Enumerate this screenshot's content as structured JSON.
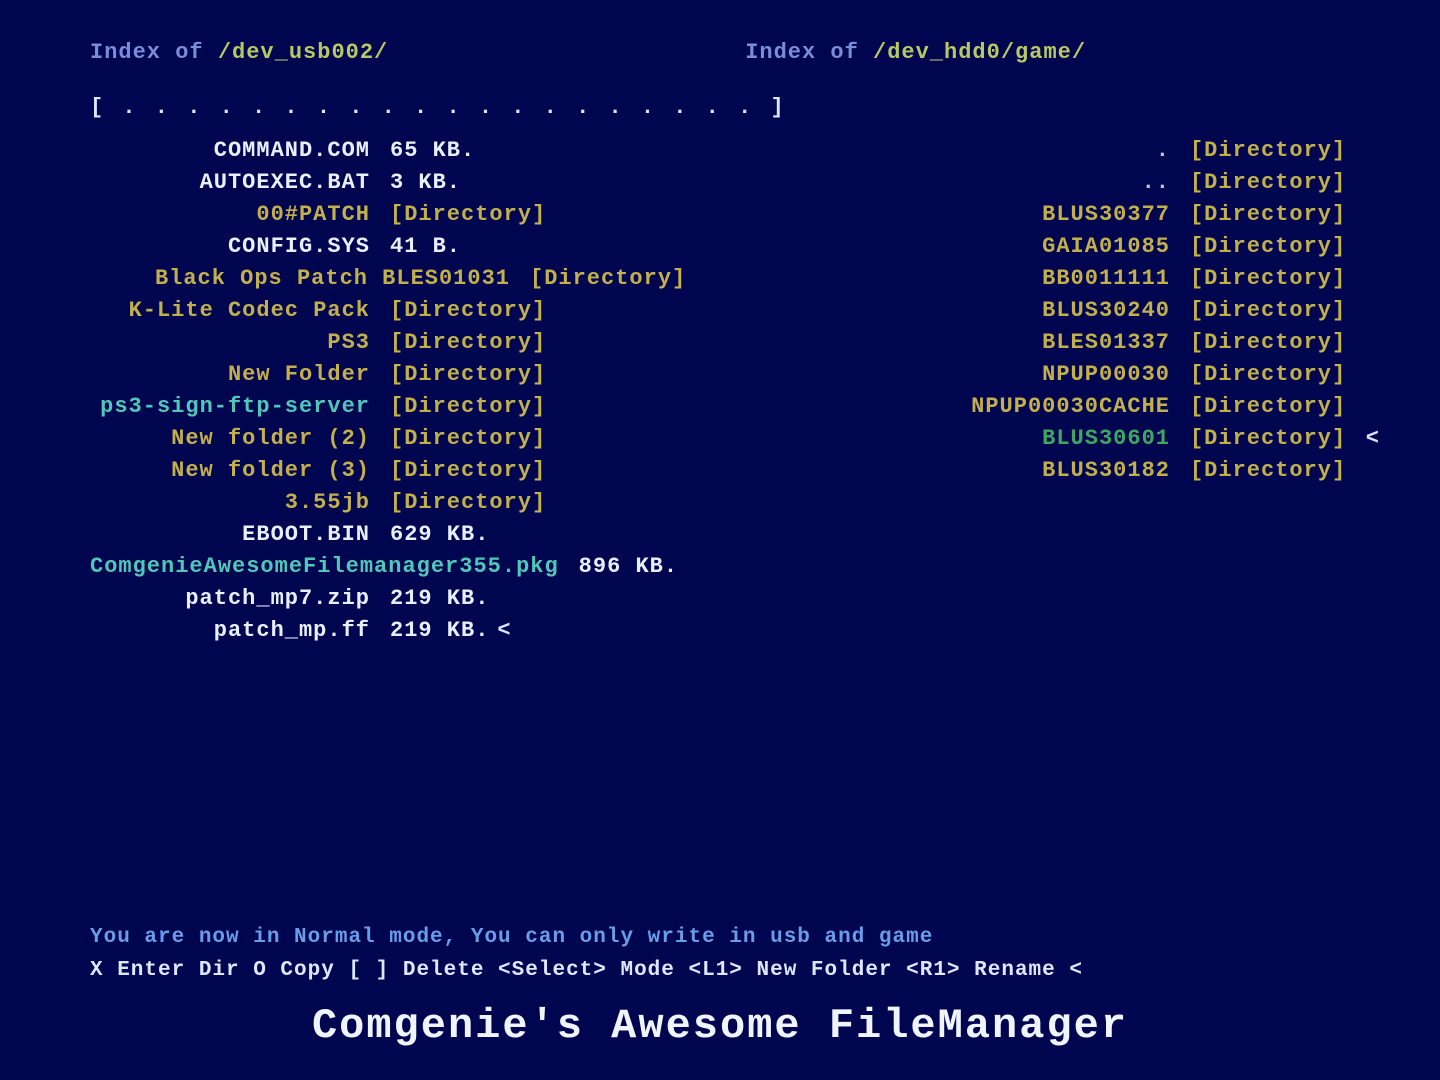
{
  "left_header": {
    "label": "Index of ",
    "path": "/dev_usb002/"
  },
  "right_header": {
    "label": "Index of ",
    "path": "/dev_hdd0/game/"
  },
  "progress": "[ . . . . . . . . . . . . . . . . . . . . ]",
  "left_files": [
    {
      "name": "COMMAND.COM",
      "info": "65 KB.",
      "name_class": "c-white",
      "info_class": "c-white",
      "wide": false,
      "cursor": false
    },
    {
      "name": "AUTOEXEC.BAT",
      "info": "3 KB.",
      "name_class": "c-white",
      "info_class": "c-white",
      "wide": false,
      "cursor": false
    },
    {
      "name": "00#PATCH",
      "info": "[Directory]",
      "name_class": "c-yellow",
      "info_class": "c-yellow",
      "wide": false,
      "cursor": false
    },
    {
      "name": "CONFIG.SYS",
      "info": "41 B.",
      "name_class": "c-white",
      "info_class": "c-white",
      "wide": false,
      "cursor": false
    },
    {
      "name": "Black Ops Patch BLES01031",
      "info": "[Directory]",
      "name_class": "c-yellow",
      "info_class": "c-yellow",
      "wide": true,
      "cursor": false
    },
    {
      "name": "K-Lite Codec Pack",
      "info": "[Directory]",
      "name_class": "c-yellow",
      "info_class": "c-yellow",
      "wide": false,
      "cursor": false
    },
    {
      "name": "PS3",
      "info": "[Directory]",
      "name_class": "c-yellow",
      "info_class": "c-yellow",
      "wide": false,
      "cursor": false
    },
    {
      "name": "New Folder",
      "info": "[Directory]",
      "name_class": "c-yellow",
      "info_class": "c-yellow",
      "wide": false,
      "cursor": false
    },
    {
      "name": "ps3-sign-ftp-server",
      "info": "[Directory]",
      "name_class": "c-cyan",
      "info_class": "c-yellow",
      "wide": false,
      "cursor": false
    },
    {
      "name": "New folder (2)",
      "info": "[Directory]",
      "name_class": "c-yellow",
      "info_class": "c-yellow",
      "wide": false,
      "cursor": false
    },
    {
      "name": "New folder (3)",
      "info": "[Directory]",
      "name_class": "c-yellow",
      "info_class": "c-yellow",
      "wide": false,
      "cursor": false
    },
    {
      "name": "3.55jb",
      "info": "[Directory]",
      "name_class": "c-yellow",
      "info_class": "c-yellow",
      "wide": false,
      "cursor": false
    },
    {
      "name": "EBOOT.BIN",
      "info": "629 KB.",
      "name_class": "c-white",
      "info_class": "c-white",
      "wide": false,
      "cursor": false
    },
    {
      "name": "ComgenieAwesomeFilemanager355.pkg",
      "info": "896 KB.",
      "name_class": "c-cyan",
      "info_class": "c-white",
      "wide": true,
      "cursor": false
    },
    {
      "name": "patch_mp7.zip",
      "info": "219 KB.",
      "name_class": "c-white",
      "info_class": "c-white",
      "wide": false,
      "cursor": false
    },
    {
      "name": "patch_mp.ff",
      "info": "219 KB.",
      "name_class": "c-white",
      "info_class": "c-white",
      "wide": false,
      "cursor": true
    }
  ],
  "right_files": [
    {
      "name": ".",
      "info": "[Directory]",
      "name_class": "c-muted",
      "info_class": "c-yellow",
      "cursor": false
    },
    {
      "name": "..",
      "info": "[Directory]",
      "name_class": "c-muted",
      "info_class": "c-yellow",
      "cursor": false
    },
    {
      "name": "BLUS30377",
      "info": "[Directory]",
      "name_class": "c-yellow",
      "info_class": "c-yellow",
      "cursor": false
    },
    {
      "name": "GAIA01085",
      "info": "[Directory]",
      "name_class": "c-yellow",
      "info_class": "c-yellow",
      "cursor": false
    },
    {
      "name": "BB0011111",
      "info": "[Directory]",
      "name_class": "c-yellow",
      "info_class": "c-yellow",
      "cursor": false
    },
    {
      "name": "BLUS30240",
      "info": "[Directory]",
      "name_class": "c-yellow",
      "info_class": "c-yellow",
      "cursor": false
    },
    {
      "name": "BLES01337",
      "info": "[Directory]",
      "name_class": "c-yellow",
      "info_class": "c-yellow",
      "cursor": false
    },
    {
      "name": "NPUP00030",
      "info": "[Directory]",
      "name_class": "c-yellow",
      "info_class": "c-yellow",
      "cursor": false
    },
    {
      "name": "NPUP00030CACHE",
      "info": "[Directory]",
      "name_class": "c-yellow",
      "info_class": "c-yellow",
      "cursor": false
    },
    {
      "name": "BLUS30601",
      "info": "[Directory]",
      "name_class": "c-green",
      "info_class": "c-yellow",
      "cursor": true
    },
    {
      "name": "BLUS30182",
      "info": "[Directory]",
      "name_class": "c-yellow",
      "info_class": "c-yellow",
      "cursor": false
    }
  ],
  "status": "You are now in Normal mode, You can only write in usb and game",
  "help": "X Enter Dir  O Copy  [ ] Delete <Select> Mode <L1> New Folder <R1> Rename <",
  "title": "Comgenie's Awesome FileManager",
  "cursor_char": "<"
}
